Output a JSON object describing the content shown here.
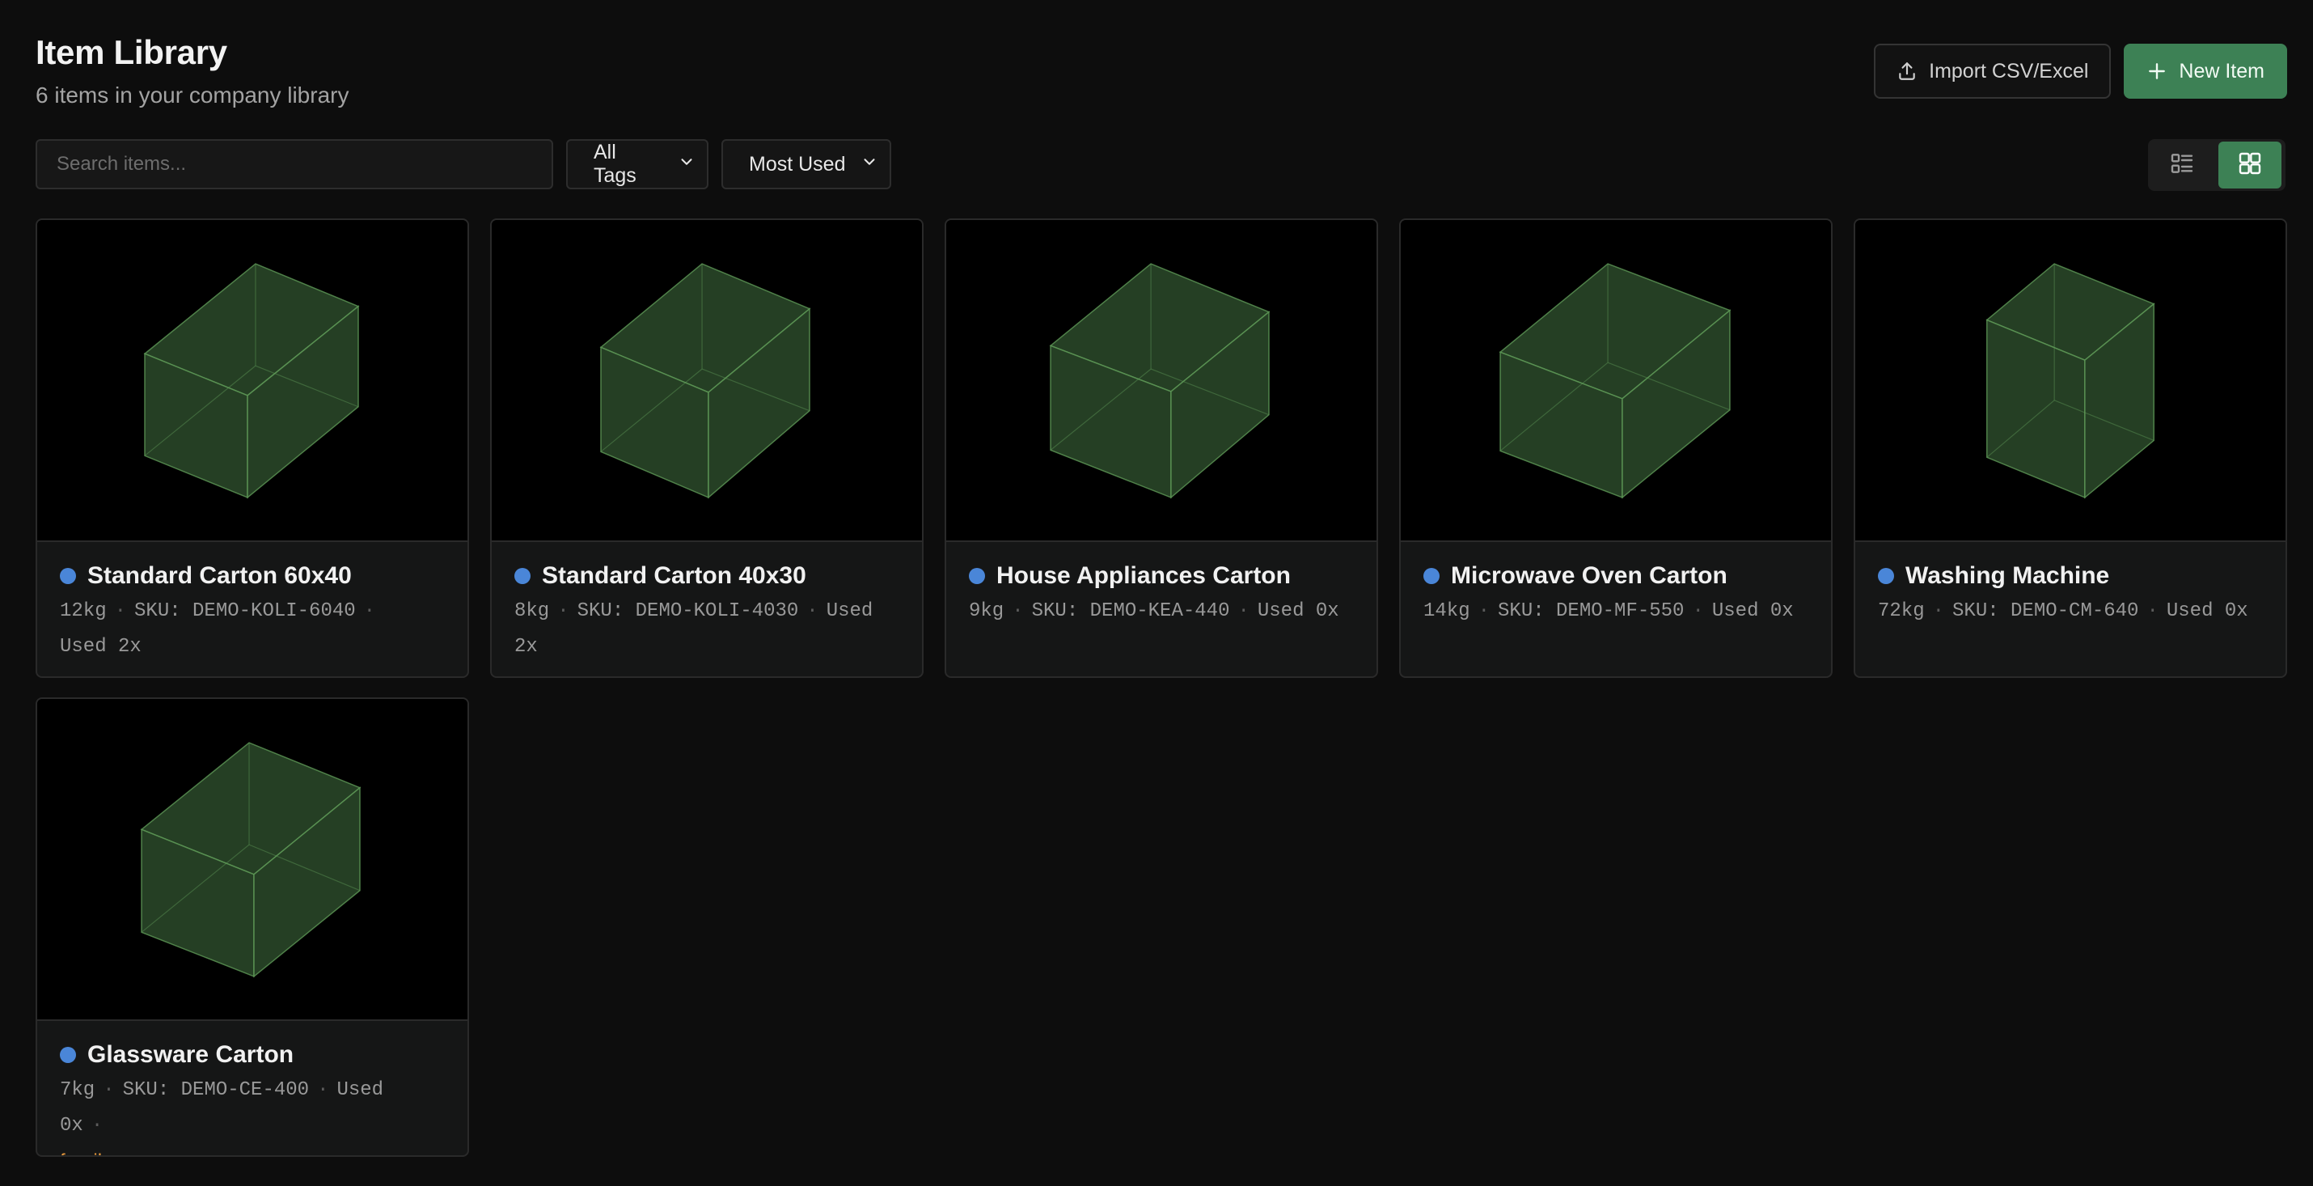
{
  "header": {
    "title": "Item Library",
    "subtitle": "6 items in your company library",
    "import_label": "Import CSV/Excel",
    "new_label": "New Item"
  },
  "toolbar": {
    "search_placeholder": "Search items...",
    "tags_value": "All Tags",
    "sort_value": "Most Used"
  },
  "colors": {
    "accent": "#3d8155",
    "dot": "#4a86d8",
    "fragile": "#e99a3c",
    "box_face": "#2c4a2a"
  },
  "items": [
    {
      "name": "Standard Carton 60x40",
      "weight": "12kg",
      "sku": "SKU: DEMO-KOLI-6040",
      "used": "Used 2x"
    },
    {
      "name": "Standard Carton 40x30",
      "weight": "8kg",
      "sku": "SKU: DEMO-KOLI-4030",
      "used": "Used 2x"
    },
    {
      "name": "House Appliances Carton",
      "weight": "9kg",
      "sku": "SKU: DEMO-KEA-440",
      "used": "Used 0x"
    },
    {
      "name": "Microwave Oven Carton",
      "weight": "14kg",
      "sku": "SKU: DEMO-MF-550",
      "used": "Used 0x"
    },
    {
      "name": "Washing Machine",
      "weight": "72kg",
      "sku": "SKU: DEMO-CM-640",
      "used": "Used 0x"
    },
    {
      "name": "Glassware Carton",
      "weight": "7kg",
      "sku": "SKU: DEMO-CE-400",
      "used": "Used 0x",
      "tag": "fragile"
    }
  ]
}
